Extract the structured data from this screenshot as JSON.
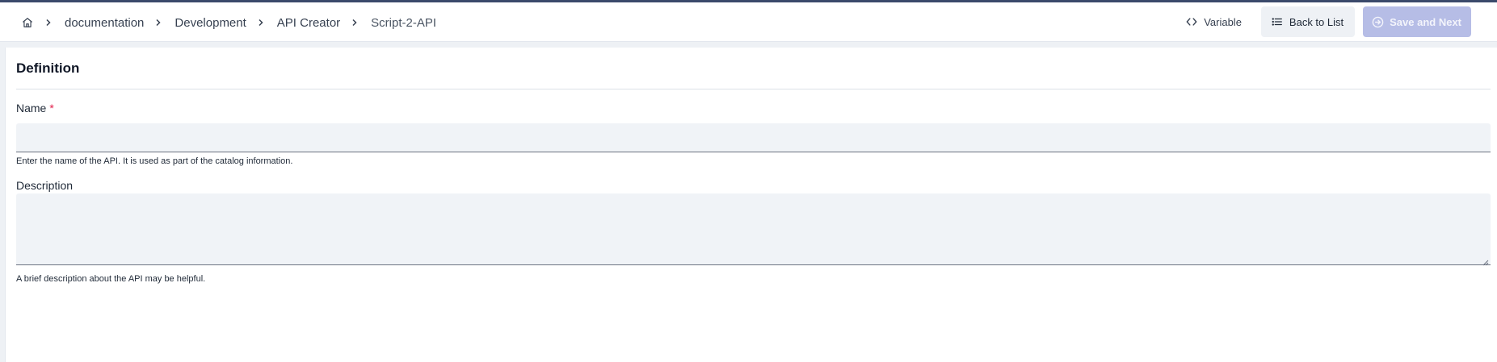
{
  "breadcrumb": {
    "home_icon": "home-icon",
    "items": [
      "documentation",
      "Development",
      "API Creator",
      "Script-2-API"
    ]
  },
  "actions": {
    "variable": {
      "label": "Variable",
      "icon": "code-brackets-icon"
    },
    "back_to_list": {
      "label": "Back to List",
      "icon": "list-icon"
    },
    "save_and_next": {
      "label": "Save and Next",
      "icon": "arrow-circle-right-icon",
      "disabled": true
    }
  },
  "form": {
    "section_title": "Definition",
    "name": {
      "label": "Name",
      "required_mark": "*",
      "value": "",
      "hint": "Enter the name of the API. It is used as part of the catalog information."
    },
    "description": {
      "label": "Description",
      "value": "",
      "hint": "A brief description about the API may be helpful."
    }
  },
  "colors": {
    "accent_disabled": "#b6bde6",
    "required": "#e11d48",
    "input_bg": "#f0f3f7"
  }
}
